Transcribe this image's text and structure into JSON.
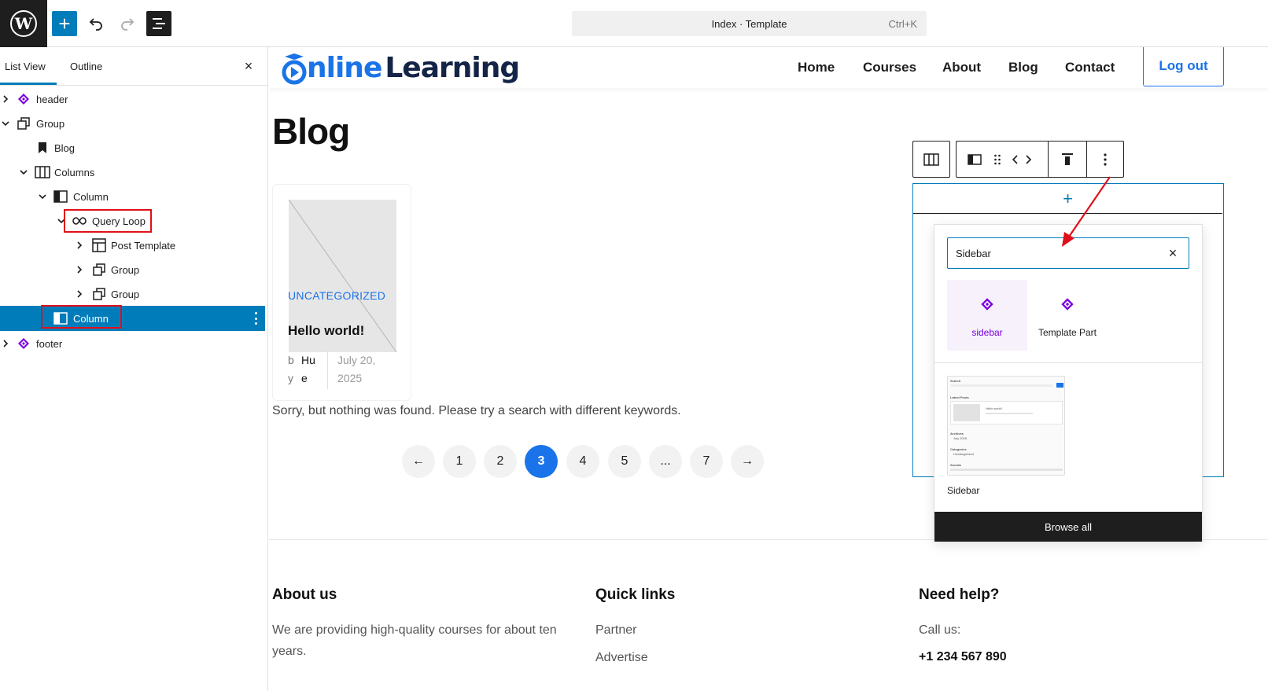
{
  "topbar": {
    "logo": "W",
    "command_title": "Index · Template",
    "command_shortcut": "Ctrl+K"
  },
  "list_panel": {
    "tabs": [
      "List View",
      "Outline"
    ],
    "active_tab": "List View",
    "close": "×",
    "items": [
      {
        "label": "header",
        "icon": "template-part-icon",
        "chevron": "right"
      },
      {
        "label": "Group",
        "icon": "group-icon",
        "chevron": "down"
      },
      {
        "label": "Blog",
        "icon": "bookmark-icon",
        "chevron": "none"
      },
      {
        "label": "Columns",
        "icon": "columns-icon",
        "chevron": "down"
      },
      {
        "label": "Column",
        "icon": "column-icon",
        "chevron": "down"
      },
      {
        "label": "Query Loop",
        "icon": "loop-icon",
        "chevron": "down",
        "highlighted": true
      },
      {
        "label": "Post Template",
        "icon": "layout-icon",
        "chevron": "right"
      },
      {
        "label": "Group",
        "icon": "group-icon",
        "chevron": "right"
      },
      {
        "label": "Group",
        "icon": "group-icon",
        "chevron": "right"
      },
      {
        "label": "Column",
        "icon": "column-icon",
        "chevron": "none",
        "selected": true,
        "highlighted": true
      },
      {
        "label": "footer",
        "icon": "template-part-icon",
        "chevron": "right"
      }
    ]
  },
  "site": {
    "logo_word1": "nline",
    "logo_word2": "Learning",
    "nav": [
      "Home",
      "Courses",
      "About",
      "Blog",
      "Contact"
    ],
    "logout": "Log out",
    "page_title": "Blog",
    "post": {
      "category": "UNCATEGORIZED",
      "title": "Hello world!",
      "meta_a": "b y",
      "meta_b": "Hu e",
      "date": "July 20, 2025"
    },
    "nothing_found": "Sorry, but nothing was found. Please try a search with different keywords.",
    "pagination": [
      "←",
      "1",
      "2",
      "3",
      "4",
      "5",
      "...",
      "7",
      "→"
    ],
    "current_page": "3",
    "footer": {
      "col1_title": "About us",
      "col1_text": "We are providing high-quality courses for about ten years.",
      "col2_title": "Quick links",
      "col2_links": [
        "Partner",
        "Advertise"
      ],
      "col3_title": "Need help?",
      "col3_label": "Call us:",
      "col3_phone": "+1 234 567 890"
    }
  },
  "inserter": {
    "plus": "+",
    "search_value": "Sidebar",
    "clear": "×",
    "results": [
      {
        "label": "sidebar",
        "icon": "template-part-icon",
        "active": true
      },
      {
        "label": "Template Part",
        "icon": "template-part-icon",
        "active": false
      }
    ],
    "pattern": {
      "label": "Sidebar",
      "preview": {
        "search": "Search",
        "latest": "Latest Posts",
        "post": "Hello world!",
        "archives": "Archives",
        "archive_item": "July 2025",
        "categories": "Categories",
        "category_item": "Uncategorized",
        "socials": "Socials"
      }
    },
    "browse_all": "Browse all"
  },
  "colors": {
    "wp_blue": "#007cba",
    "site_blue": "#1a73e8",
    "dark": "#1e1e1e",
    "purple": "#7a00df",
    "annotation_red": "#e0101a"
  }
}
